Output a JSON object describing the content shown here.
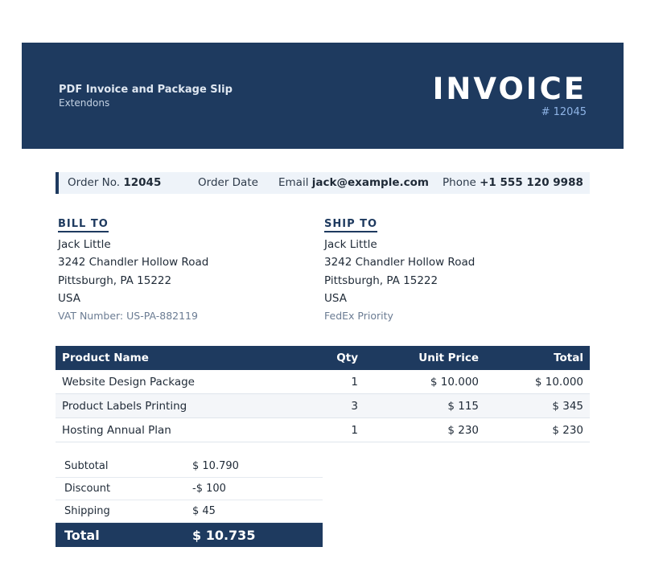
{
  "header": {
    "app_title": "PDF Invoice and Package Slip",
    "app_subtitle": "Extendons",
    "doc_title": "INVOICE",
    "doc_number": "# 12045"
  },
  "order_bar": {
    "order_no_label": "Order No.",
    "order_no_value": "12045",
    "order_date_label": "Order Date",
    "email_label": "Email",
    "email_value": "jack@example.com",
    "phone_label": "Phone",
    "phone_value": "+1 555 120 9988"
  },
  "bill_to": {
    "heading": "BILL TO",
    "name": "Jack Little",
    "street": "3242 Chandler Hollow Road",
    "city": "Pittsburgh, PA 15222",
    "country": "USA",
    "extra": "VAT Number: US-PA-882119"
  },
  "ship_to": {
    "heading": "SHIP TO",
    "name": "Jack Little",
    "street": "3242 Chandler Hollow Road",
    "city": "Pittsburgh, PA 15222",
    "country": "USA",
    "extra": "FedEx Priority"
  },
  "items_table": {
    "headers": [
      "Product Name",
      "Qty",
      "Unit Price",
      "Total"
    ],
    "rows": [
      [
        "Website Design Package",
        "1",
        "$ 10.000",
        "$ 10.000"
      ],
      [
        "Product Labels Printing",
        "3",
        "$ 115",
        "$ 345"
      ],
      [
        "Hosting Annual Plan",
        "1",
        "$ 230",
        "$ 230"
      ]
    ]
  },
  "totals": {
    "subtotal_label": "Subtotal",
    "subtotal_value": "$ 10.790",
    "discount_label": "Discount",
    "discount_value": "-$ 100",
    "shipping_label": "Shipping",
    "shipping_value": "$ 45",
    "total_label": "Total",
    "total_value": "$ 10.735"
  },
  "colors": {
    "brand": "#1e3a5f",
    "accent": "#8fb4e6",
    "bar_bg": "#eef3f9"
  }
}
